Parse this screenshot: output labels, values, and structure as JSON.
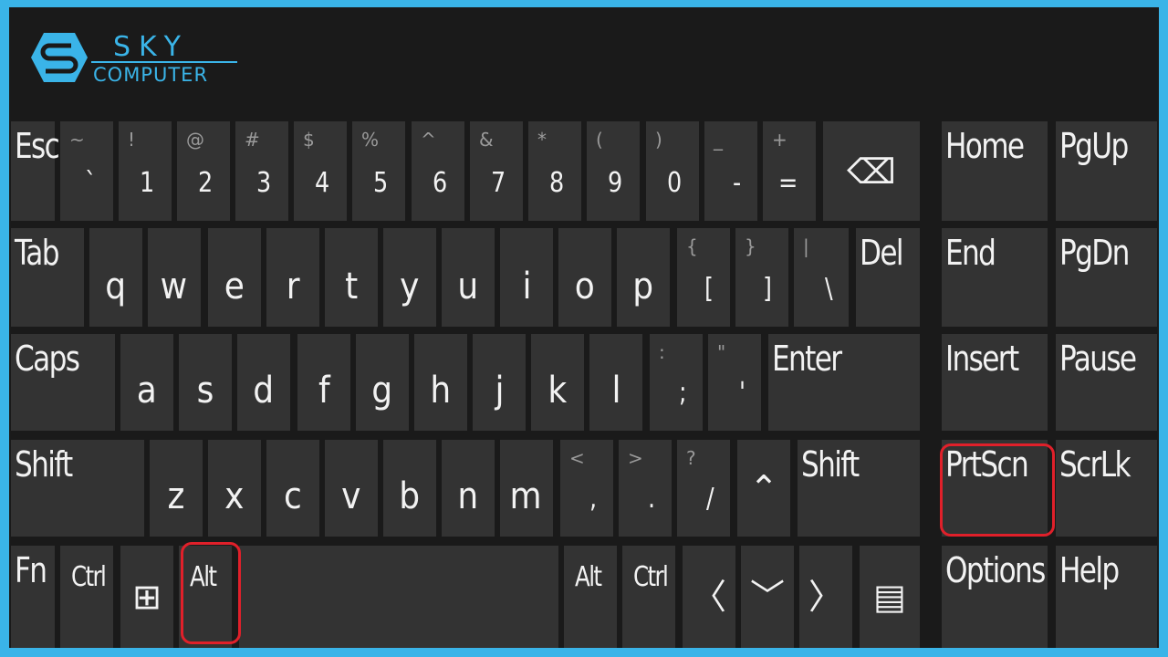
{
  "brand": {
    "name": "SKY",
    "sub": "COMPUTER",
    "color": "#3ab4e8"
  },
  "highlight_color": "#e0202a",
  "highlighted_keys": [
    "Alt",
    "PrtScn"
  ],
  "rows": [
    [
      {
        "label": "Esc"
      },
      {
        "label": "`",
        "shift": "~"
      },
      {
        "label": "1",
        "shift": "!"
      },
      {
        "label": "2",
        "shift": "@"
      },
      {
        "label": "3",
        "shift": "#"
      },
      {
        "label": "4",
        "shift": "$"
      },
      {
        "label": "5",
        "shift": "%"
      },
      {
        "label": "6",
        "shift": "^"
      },
      {
        "label": "7",
        "shift": "&"
      },
      {
        "label": "8",
        "shift": "*"
      },
      {
        "label": "9",
        "shift": "("
      },
      {
        "label": "0",
        "shift": ")"
      },
      {
        "label": "-",
        "shift": "_"
      },
      {
        "label": "=",
        "shift": "+"
      },
      {
        "label": "⌫",
        "icon": "backspace-icon"
      }
    ],
    [
      {
        "label": "Tab"
      },
      {
        "label": "q"
      },
      {
        "label": "w"
      },
      {
        "label": "e"
      },
      {
        "label": "r"
      },
      {
        "label": "t"
      },
      {
        "label": "y"
      },
      {
        "label": "u"
      },
      {
        "label": "i"
      },
      {
        "label": "o"
      },
      {
        "label": "p"
      },
      {
        "label": "[",
        "shift": "{"
      },
      {
        "label": "]",
        "shift": "}"
      },
      {
        "label": "\\",
        "shift": "|"
      },
      {
        "label": "Del"
      }
    ],
    [
      {
        "label": "Caps"
      },
      {
        "label": "a"
      },
      {
        "label": "s"
      },
      {
        "label": "d"
      },
      {
        "label": "f"
      },
      {
        "label": "g"
      },
      {
        "label": "h"
      },
      {
        "label": "j"
      },
      {
        "label": "k"
      },
      {
        "label": "l"
      },
      {
        "label": ";",
        "shift": ":"
      },
      {
        "label": "'",
        "shift": "\""
      },
      {
        "label": "Enter"
      }
    ],
    [
      {
        "label": "Shift"
      },
      {
        "label": "z"
      },
      {
        "label": "x"
      },
      {
        "label": "c"
      },
      {
        "label": "v"
      },
      {
        "label": "b"
      },
      {
        "label": "n"
      },
      {
        "label": "m"
      },
      {
        "label": ",",
        "shift": "<"
      },
      {
        "label": ".",
        "shift": ">"
      },
      {
        "label": "/",
        "shift": "?"
      },
      {
        "label": "⌃",
        "icon": "arrow-up-icon"
      },
      {
        "label": "Shift"
      }
    ],
    [
      {
        "label": "Fn"
      },
      {
        "label": "Ctrl"
      },
      {
        "label": "⊞",
        "icon": "windows-icon"
      },
      {
        "label": "Alt"
      },
      {
        "label": "",
        "icon": "spacebar"
      },
      {
        "label": "Alt"
      },
      {
        "label": "Ctrl"
      },
      {
        "label": "〈",
        "icon": "arrow-left-icon"
      },
      {
        "label": "﹀",
        "icon": "arrow-down-icon"
      },
      {
        "label": "〉",
        "icon": "arrow-right-icon"
      },
      {
        "label": "▤",
        "icon": "menu-icon"
      }
    ]
  ],
  "nav": [
    [
      {
        "label": "Home"
      },
      {
        "label": "PgUp"
      }
    ],
    [
      {
        "label": "End"
      },
      {
        "label": "PgDn"
      }
    ],
    [
      {
        "label": "Insert"
      },
      {
        "label": "Pause"
      }
    ],
    [
      {
        "label": "PrtScn"
      },
      {
        "label": "ScrLk"
      }
    ],
    [
      {
        "label": "Options"
      },
      {
        "label": "Help"
      }
    ]
  ]
}
